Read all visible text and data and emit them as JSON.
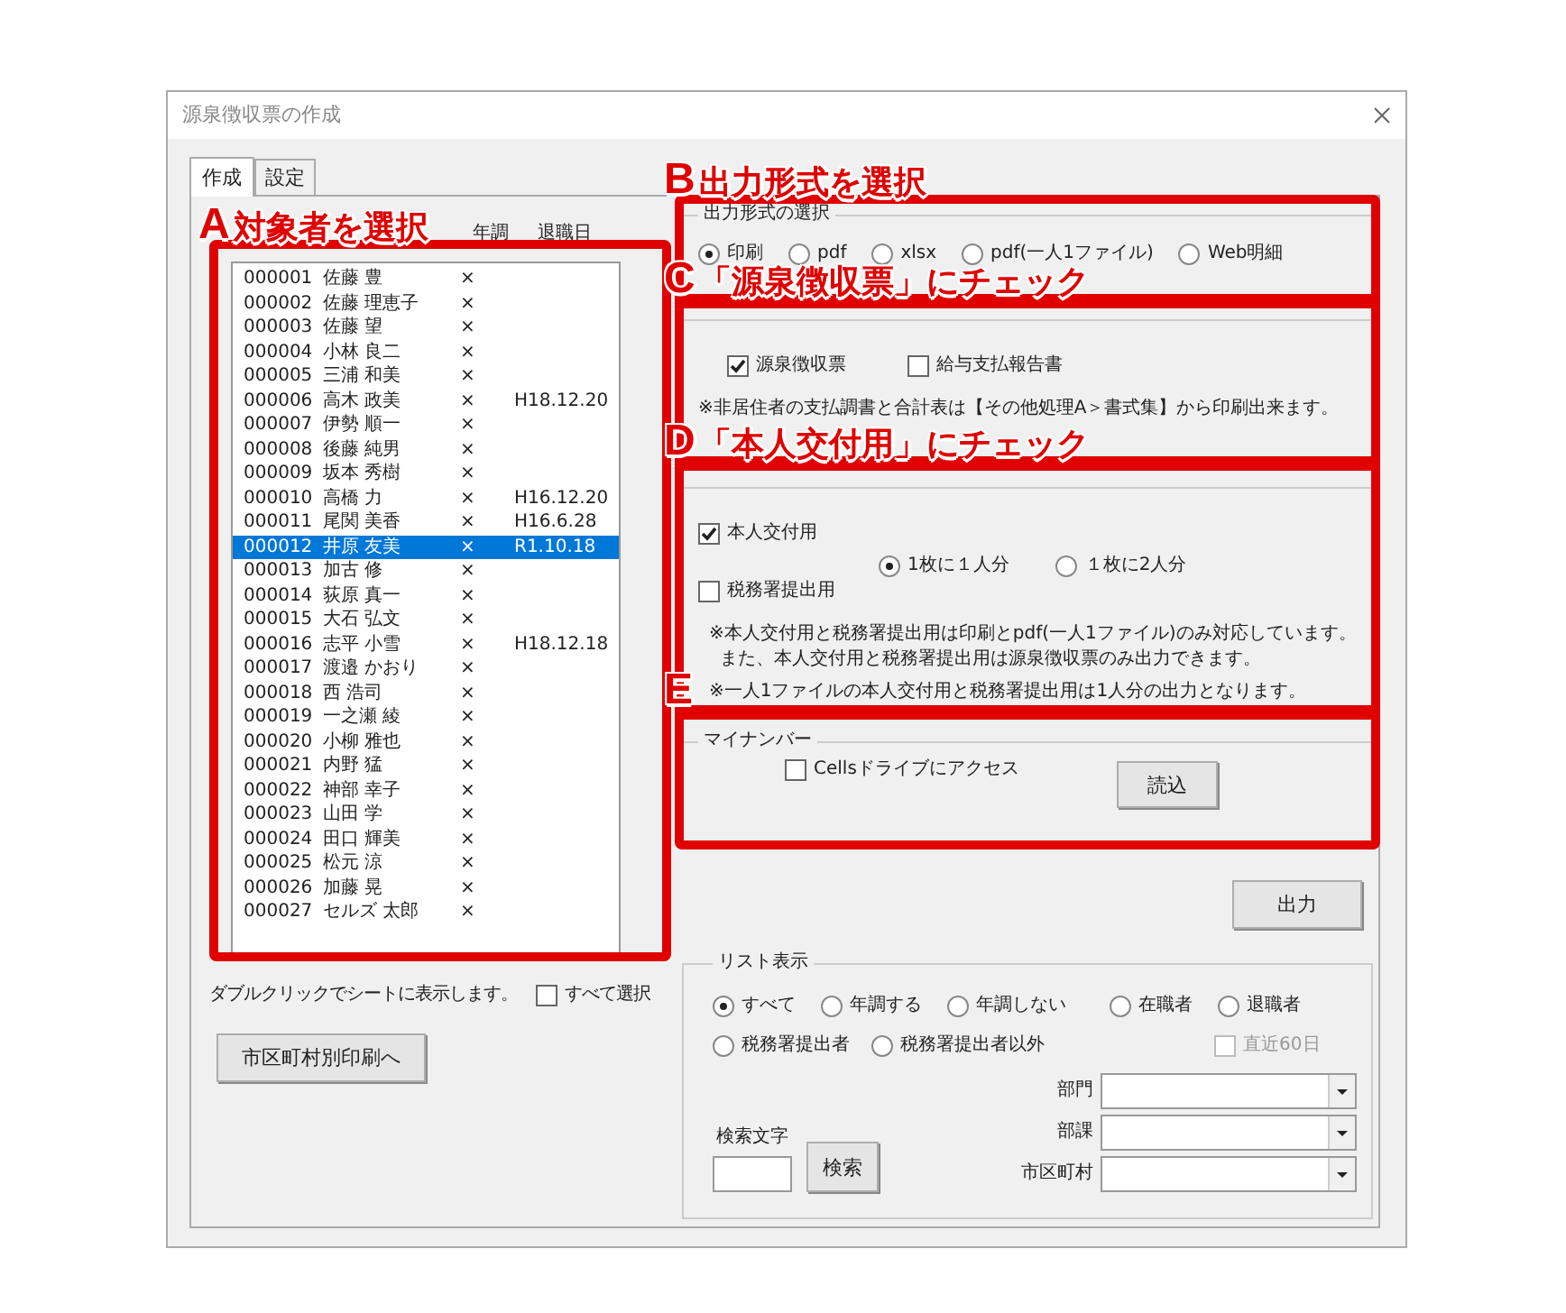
{
  "window": {
    "title": "源泉徴収票の作成"
  },
  "tabs": [
    {
      "label": "作成",
      "selected": true
    },
    {
      "label": "設定",
      "selected": false
    }
  ],
  "employees": {
    "columns": [
      "年調",
      "退職日"
    ],
    "rows": [
      {
        "code": "000001",
        "name": "佐藤 豊",
        "nencho": "×",
        "retired": "",
        "selected": false
      },
      {
        "code": "000002",
        "name": "佐藤 理恵子",
        "nencho": "×",
        "retired": "",
        "selected": false
      },
      {
        "code": "000003",
        "name": "佐藤 望",
        "nencho": "×",
        "retired": "",
        "selected": false
      },
      {
        "code": "000004",
        "name": "小林 良二",
        "nencho": "×",
        "retired": "",
        "selected": false
      },
      {
        "code": "000005",
        "name": "三浦 和美",
        "nencho": "×",
        "retired": "",
        "selected": false
      },
      {
        "code": "000006",
        "name": "高木 政美",
        "nencho": "×",
        "retired": "H18.12.20",
        "selected": false
      },
      {
        "code": "000007",
        "name": "伊勢 順一",
        "nencho": "×",
        "retired": "",
        "selected": false
      },
      {
        "code": "000008",
        "name": "後藤 純男",
        "nencho": "×",
        "retired": "",
        "selected": false
      },
      {
        "code": "000009",
        "name": "坂本 秀樹",
        "nencho": "×",
        "retired": "",
        "selected": false
      },
      {
        "code": "000010",
        "name": "高橋 力",
        "nencho": "×",
        "retired": "H16.12.20",
        "selected": false
      },
      {
        "code": "000011",
        "name": "尾関 美香",
        "nencho": "×",
        "retired": "H16.6.28",
        "selected": false
      },
      {
        "code": "000012",
        "name": "井原 友美",
        "nencho": "×",
        "retired": "R1.10.18",
        "selected": true
      },
      {
        "code": "000013",
        "name": "加古 修",
        "nencho": "×",
        "retired": "",
        "selected": false
      },
      {
        "code": "000014",
        "name": "荻原 真一",
        "nencho": "×",
        "retired": "",
        "selected": false
      },
      {
        "code": "000015",
        "name": "大石 弘文",
        "nencho": "×",
        "retired": "",
        "selected": false
      },
      {
        "code": "000016",
        "name": "志平 小雪",
        "nencho": "×",
        "retired": "H18.12.18",
        "selected": false
      },
      {
        "code": "000017",
        "name": "渡邉 かおり",
        "nencho": "×",
        "retired": "",
        "selected": false
      },
      {
        "code": "000018",
        "name": "西 浩司",
        "nencho": "×",
        "retired": "",
        "selected": false
      },
      {
        "code": "000019",
        "name": "一之瀬 綾",
        "nencho": "×",
        "retired": "",
        "selected": false
      },
      {
        "code": "000020",
        "name": "小柳 雅也",
        "nencho": "×",
        "retired": "",
        "selected": false
      },
      {
        "code": "000021",
        "name": "内野 猛",
        "nencho": "×",
        "retired": "",
        "selected": false
      },
      {
        "code": "000022",
        "name": "神部 幸子",
        "nencho": "×",
        "retired": "",
        "selected": false
      },
      {
        "code": "000023",
        "name": "山田 学",
        "nencho": "×",
        "retired": "",
        "selected": false
      },
      {
        "code": "000024",
        "name": "田口 輝美",
        "nencho": "×",
        "retired": "",
        "selected": false
      },
      {
        "code": "000025",
        "name": "松元 涼",
        "nencho": "×",
        "retired": "",
        "selected": false
      },
      {
        "code": "000026",
        "name": "加藤 晃",
        "nencho": "×",
        "retired": "",
        "selected": false
      },
      {
        "code": "000027",
        "name": "セルズ  太郎",
        "nencho": "×",
        "retired": "",
        "selected": false
      }
    ]
  },
  "list_hint": "ダブルクリックでシートに表示します。",
  "select_all": {
    "label": "すべて選択",
    "checked": false
  },
  "municipal_button": "市区町村別印刷へ",
  "output_format": {
    "title": "出力形式の選択",
    "options": [
      {
        "label": "印刷",
        "selected": true
      },
      {
        "label": "pdf",
        "selected": false
      },
      {
        "label": "xlsx",
        "selected": false
      },
      {
        "label": "pdf(一人1ファイル)",
        "selected": false
      },
      {
        "label": "Web明細",
        "selected": false
      }
    ]
  },
  "forms": {
    "checks": [
      {
        "label": "源泉徴収票",
        "checked": true
      },
      {
        "label": "給与支払報告書",
        "checked": false
      }
    ],
    "note": "※非居住者の支払調書と合計表は【その他処理A＞書式集】から印刷出来ます。"
  },
  "copies": {
    "checks": [
      {
        "label": "本人交付用",
        "checked": true
      },
      {
        "label": "税務署提出用",
        "checked": false
      }
    ],
    "layouts": [
      {
        "label": "1枚に１人分",
        "selected": true
      },
      {
        "label": "１枚に2人分",
        "selected": false
      }
    ],
    "notes": [
      "※本人交付用と税務署提出用は印刷とpdf(一人1ファイル)のみ対応しています。",
      "また、本人交付用と税務署提出用は源泉徴収票のみ出力できます。",
      "※一人1ファイルの本人交付用と税務署提出用は1人分の出力となります。"
    ]
  },
  "my_number": {
    "title": "マイナンバー",
    "check": {
      "label": "Cellsドライブにアクセス",
      "checked": false
    },
    "button": "読込"
  },
  "output_button": "出力",
  "list_view": {
    "title": "リスト表示",
    "filters": [
      {
        "label": "すべて",
        "selected": true
      },
      {
        "label": "年調する",
        "selected": false
      },
      {
        "label": "年調しない",
        "selected": false
      },
      {
        "label": "在職者",
        "selected": false
      },
      {
        "label": "退職者",
        "selected": false
      },
      {
        "label": "税務署提出者",
        "selected": false
      },
      {
        "label": "税務署提出者以外",
        "selected": false
      }
    ],
    "recent": {
      "label": "直近60日",
      "checked": false,
      "disabled": true
    },
    "search_label": "検索文字",
    "search_button": "検索",
    "dropdowns": [
      {
        "label": "部門"
      },
      {
        "label": "部課"
      },
      {
        "label": "市区町村"
      }
    ]
  },
  "annotations": [
    {
      "letter": "A",
      "text": "対象者を選択"
    },
    {
      "letter": "B",
      "text": "出力形式を選択"
    },
    {
      "letter": "C",
      "text": "「源泉徴収票」にチェック"
    },
    {
      "letter": "D",
      "text": "「本人交付用」にチェック"
    },
    {
      "letter": "E"
    }
  ]
}
